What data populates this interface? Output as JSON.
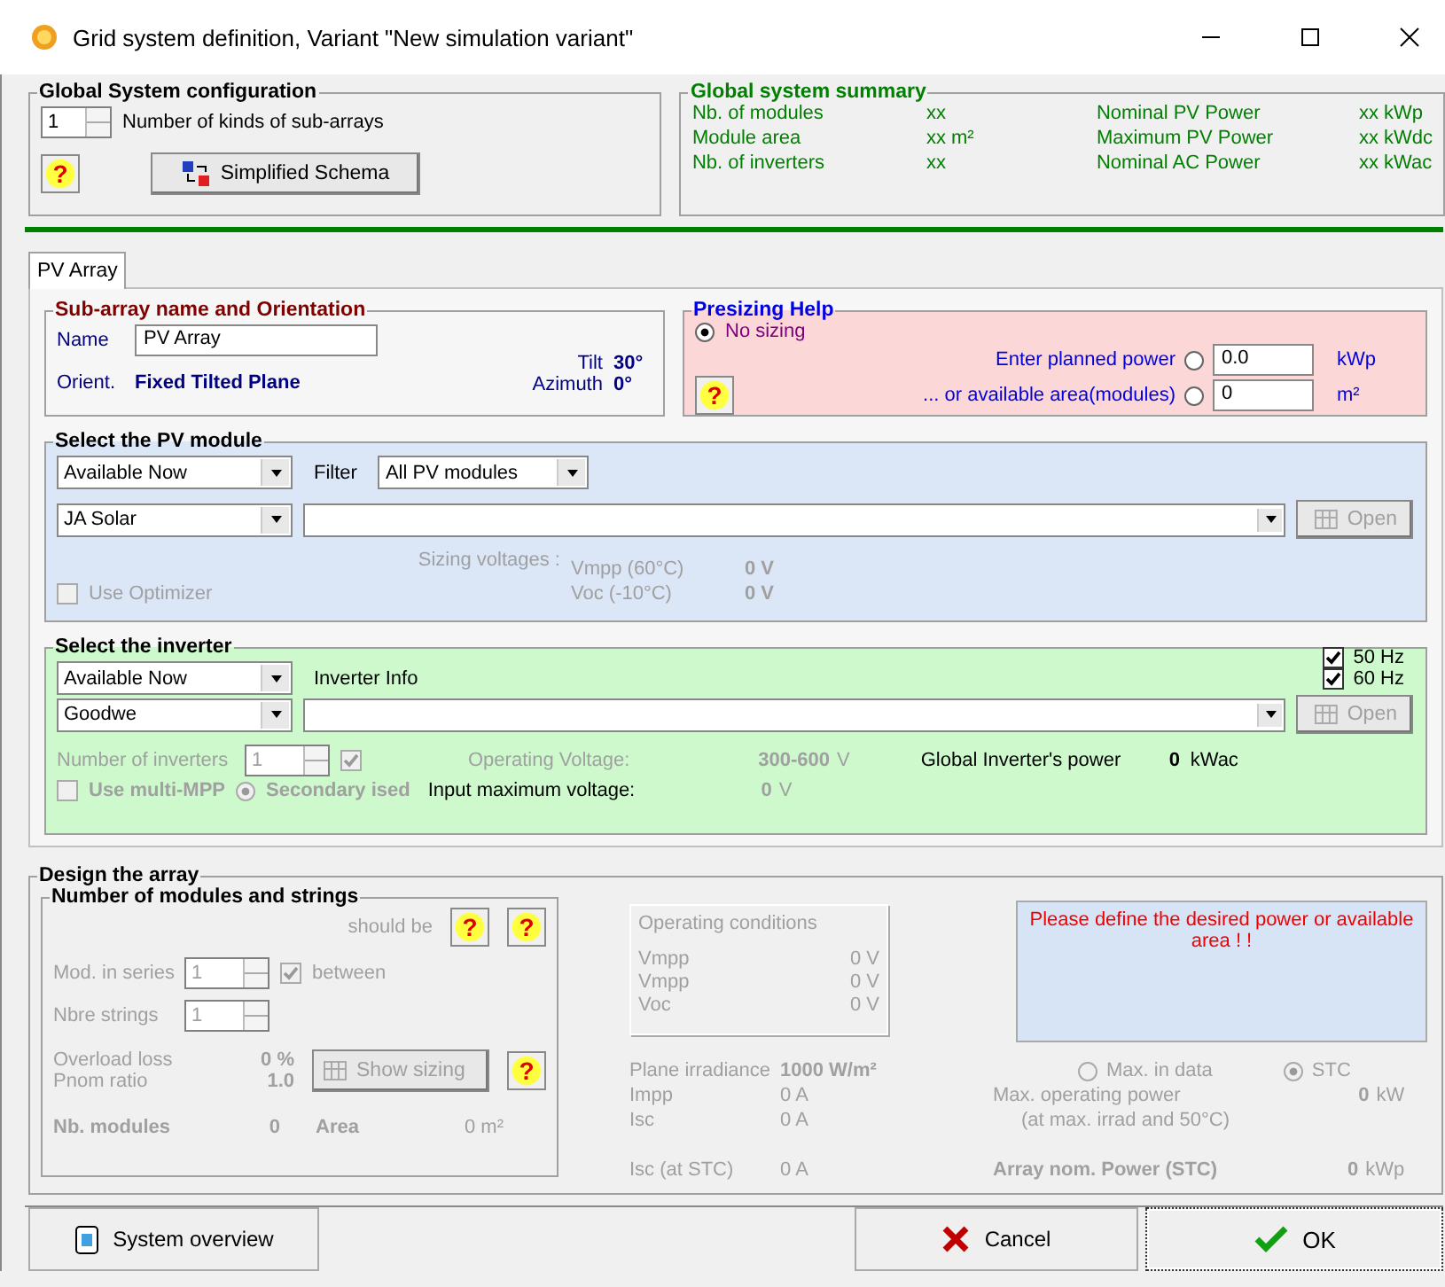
{
  "window": {
    "title": "Grid system definition, Variant  \"New simulation variant\""
  },
  "global_config": {
    "title": "Global System configuration",
    "count": "1",
    "count_label": "Number of kinds of sub-arrays",
    "help": "?",
    "schema_button": "Simplified Schema"
  },
  "summary": {
    "title": "Global system summary",
    "rows": [
      {
        "label": "Nb. of modules",
        "value": "xx",
        "label2": "Nominal PV Power",
        "value2": "xx  kWp"
      },
      {
        "label": "Module area",
        "value": "xx m²",
        "label2": "Maximum PV Power",
        "value2": "xx  kWdc"
      },
      {
        "label": "Nb. of inverters",
        "value": "xx",
        "label2": "Nominal AC Power",
        "value2": "xx  kWac"
      }
    ]
  },
  "tabs": [
    {
      "label": "PV Array",
      "selected": true
    }
  ],
  "orientation": {
    "title": "Sub-array name and Orientation",
    "name_label": "Name",
    "name_value": "PV Array",
    "orient_label": "Orient.",
    "orient_value": "Fixed Tilted Plane",
    "tilt_label": "Tilt",
    "tilt_value": "30°",
    "azimuth_label": "Azimuth",
    "azimuth_value": "0°"
  },
  "presizing": {
    "title": "Presizing Help",
    "help": "?",
    "options": [
      {
        "label": "No sizing",
        "selected": true
      },
      {
        "label": "Enter planned power",
        "selected": false,
        "value": "0.0",
        "unit": "kWp"
      },
      {
        "label": "...  or available area(modules)",
        "selected": false,
        "value": "0",
        "unit": "m²"
      }
    ]
  },
  "pv_module": {
    "title": "Select the PV module",
    "availability": "Available Now",
    "filter_label": "Filter",
    "filter": "All PV modules",
    "manufacturer": "JA Solar",
    "open_button": "Open",
    "optimizer": {
      "label": "Use Optimizer",
      "checked": false
    },
    "sizing_label": "Sizing voltages :",
    "voltages": [
      {
        "label": "Vmpp (60°C)",
        "value": "0 V"
      },
      {
        "label": "Voc  (-10°C)",
        "value": "0 V"
      }
    ]
  },
  "inverter": {
    "title": "Select the inverter",
    "availability": "Available Now",
    "info_label": "Inverter Info",
    "frequencies": [
      {
        "label": "50 Hz",
        "checked": true
      },
      {
        "label": "60 Hz",
        "checked": true
      }
    ],
    "manufacturer": "Goodwe",
    "open_button": "Open",
    "count_label": "Number of inverters",
    "count": "1",
    "count_checked": true,
    "op_voltage_label": "Operating Voltage:",
    "op_voltage": "300-600",
    "op_voltage_unit": "V",
    "power_label": "Global Inverter's power",
    "power": "0",
    "power_unit": "kWac",
    "multi_mpp": {
      "label": "Use multi-MPP",
      "checked": false
    },
    "secondary": {
      "label": "Secondary ised",
      "selected": true
    },
    "max_voltage_label": "Input maximum voltage:",
    "max_voltage": "0",
    "max_voltage_unit": "V"
  },
  "design": {
    "title": "Design the array",
    "modules_strings": {
      "title": "Number of modules and strings",
      "should_be": "should be",
      "helps": [
        "?",
        "?"
      ],
      "series_label": "Mod. in series",
      "series": "1",
      "between": {
        "label": "between",
        "checked": true
      },
      "strings_label": "Nbre strings",
      "strings": "1",
      "overload_label": "Overload loss",
      "overload": "0 %",
      "pnom_label": "Pnom ratio",
      "pnom": "1.0",
      "show_sizing": "Show sizing",
      "help": "?",
      "nb_modules_label": "Nb. modules",
      "nb_modules": "0",
      "area_label": "Area",
      "area": "0 m²"
    },
    "operating": {
      "title": "Operating conditions",
      "rows": [
        {
          "label": "Vmpp",
          "value": "0 V"
        },
        {
          "label": "Vmpp",
          "value": "0 V"
        },
        {
          "label": "Voc",
          "value": "0 V"
        }
      ]
    },
    "message": "Please define the desired power or available area ! !",
    "irradiance_label": "Plane irradiance",
    "irradiance": "1000 W/m²",
    "power_modes": [
      {
        "label": "Max. in data",
        "selected": false
      },
      {
        "label": "STC",
        "selected": true
      }
    ],
    "impp_label": "Impp",
    "impp": "0 A",
    "isc_label": "Isc",
    "isc": "0 A",
    "max_power_label": "Max. operating power",
    "max_power": "0",
    "max_power_unit": "kW",
    "max_power_note": "(at max. irrad and 50°C)",
    "isc_stc_label": "Isc (at STC)",
    "isc_stc": "0 A",
    "nom_power_label": "Array nom. Power (STC)",
    "nom_power": "0",
    "nom_power_unit": "kWp"
  },
  "buttons": [
    {
      "label": "System overview",
      "kind": "overview"
    },
    {
      "label": "Cancel",
      "kind": "cancel"
    },
    {
      "label": "OK",
      "kind": "ok"
    }
  ]
}
